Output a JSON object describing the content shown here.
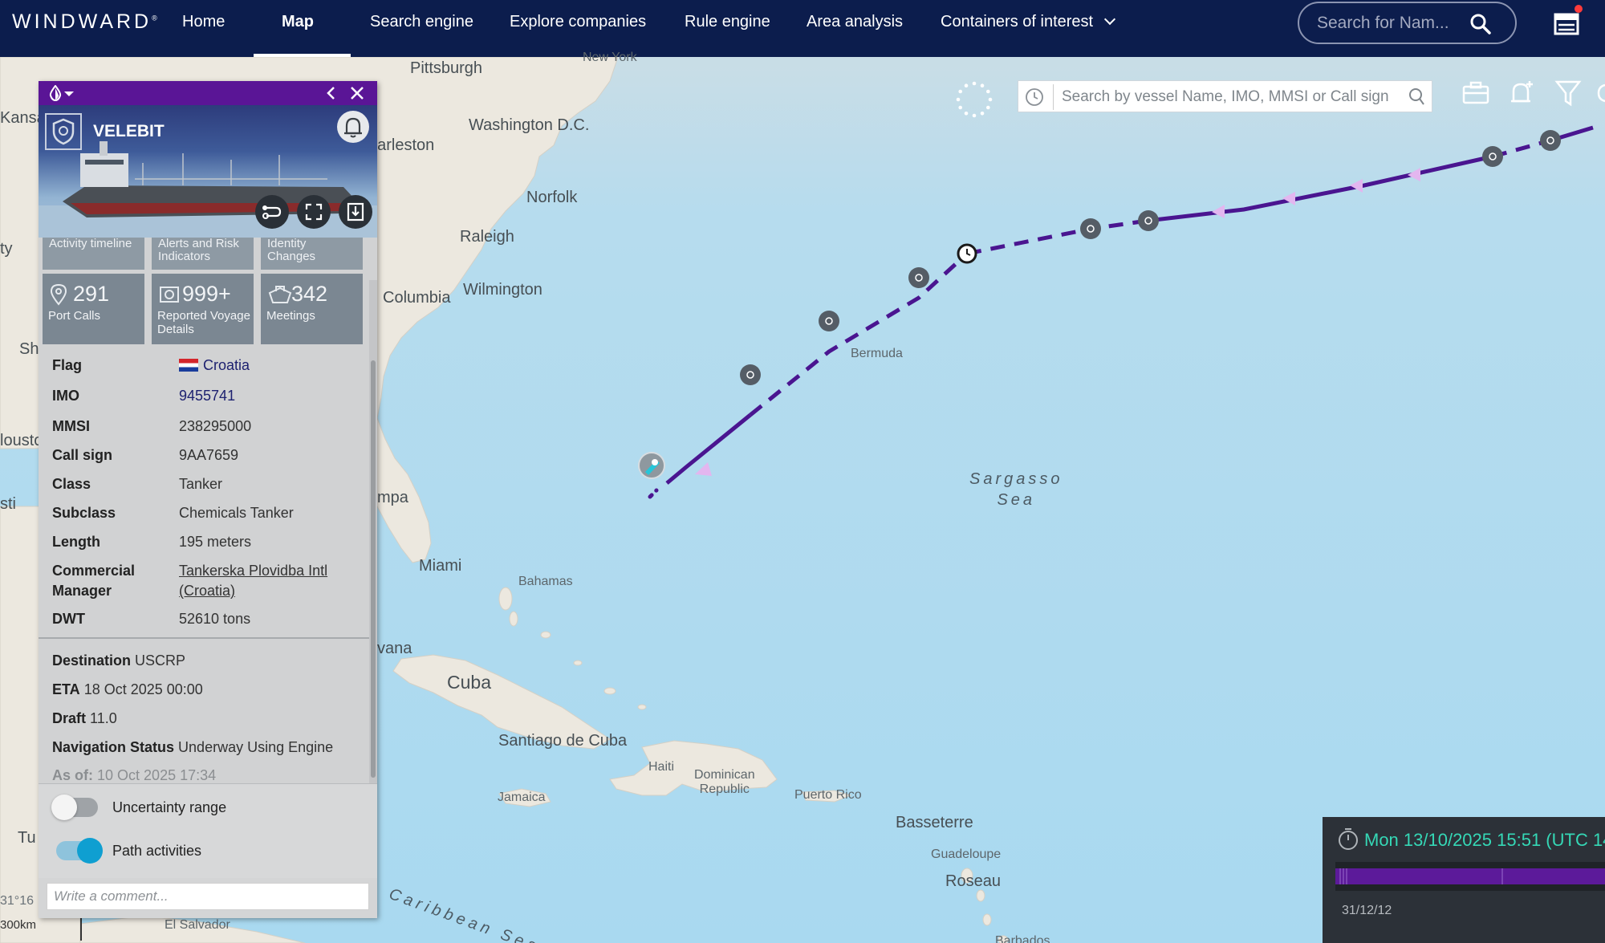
{
  "nav": {
    "logo": "WINDWARD",
    "logo_mark": "®",
    "items": [
      {
        "label": "Home"
      },
      {
        "label": "Map"
      },
      {
        "label": "Search engine"
      },
      {
        "label": "Explore companies"
      },
      {
        "label": "Rule engine"
      },
      {
        "label": "Area analysis"
      },
      {
        "label": "Containers of interest"
      }
    ],
    "active": "Map",
    "search_placeholder": "Search for Nam...",
    "notification_color": "#ff3b3b"
  },
  "map_search": {
    "placeholder": "Search by vessel Name, IMO, MMSI or Call sign"
  },
  "map_labels": {
    "pittsburgh": "Pittsburgh",
    "new_york": "New York",
    "washington": "Washington D.C.",
    "charleston": "harleston",
    "norfolk": "Norfolk",
    "raleigh": "Raleigh",
    "wilmington": "Wilmington",
    "columbia": "Columbia",
    "bermuda": "Bermuda",
    "sargasso": "Sargasso",
    "sea": "Sea",
    "tampa": "mpa",
    "miami": "Miami",
    "bahamas": "Bahamas",
    "havana": "vana",
    "cuba": "Cuba",
    "santiago": "Santiago de Cuba",
    "haiti": "Haiti",
    "dominican": "Dominican",
    "republic": "Republic",
    "jamaica": "Jamaica",
    "puerto_rico": "Puerto Rico",
    "basseterre": "Basseterre",
    "guadeloupe": "Guadeloupe",
    "roseau": "Roseau",
    "barbados": "Barbados",
    "caribbean": "Caribbean Sea",
    "el_salvador": "El Salvador",
    "kansas": "Kansa",
    "ty": "ty",
    "sh": "Sh",
    "housto": "lousto",
    "sti": "sti",
    "tu": "Tu",
    "coord": "31°16"
  },
  "panel": {
    "vessel_name": "VELEBIT",
    "tabs": [
      "Activity timeline",
      "Alerts and Risk Indicators",
      "Identity Changes"
    ],
    "stats": [
      {
        "value": "291",
        "label": "Port Calls",
        "icon": "pin-icon"
      },
      {
        "value": "999+",
        "label": "Reported Voyage Details",
        "icon": "cycle-icon"
      },
      {
        "value": "342",
        "label": "Meetings",
        "icon": "ships-icon"
      }
    ],
    "details": [
      {
        "key": "Flag",
        "value": "Croatia"
      },
      {
        "key": "IMO",
        "value": "9455741"
      },
      {
        "key": "MMSI",
        "value": "238295000"
      },
      {
        "key": "Call sign",
        "value": "9AA7659"
      },
      {
        "key": "Class",
        "value": "Tanker"
      },
      {
        "key": "Subclass",
        "value": "Chemicals Tanker"
      },
      {
        "key": "Length",
        "value": "195 meters"
      },
      {
        "key": "Commercial Manager",
        "value": "Tankerska Plovidba Intl (Croatia)"
      },
      {
        "key": "DWT",
        "value": "52610 tons"
      }
    ],
    "status": {
      "destination_key": "Destination",
      "destination": "USCRP",
      "eta_key": "ETA",
      "eta": "18 Oct 2025 00:00",
      "draft_key": "Draft",
      "draft": "11.0",
      "nav_key": "Navigation Status",
      "nav": "Underway Using Engine",
      "asof_key": "As of:",
      "asof": "10 Oct 2025 17:34"
    },
    "toggles": [
      {
        "label": "Uncertainty range",
        "on": false
      },
      {
        "label": "Path activities",
        "on": true
      }
    ],
    "comment_placeholder": "Write a comment...",
    "accent_color": "#5a1596"
  },
  "timeline": {
    "current": "Mon 13/10/2025 15:51 (UTC 14",
    "start": "31/12/12"
  },
  "scale": "300km",
  "colors": {
    "sea": "#a9d9f0",
    "land": "#ece8df",
    "track": "#4a1590",
    "timestamp": "#35d8b6"
  }
}
